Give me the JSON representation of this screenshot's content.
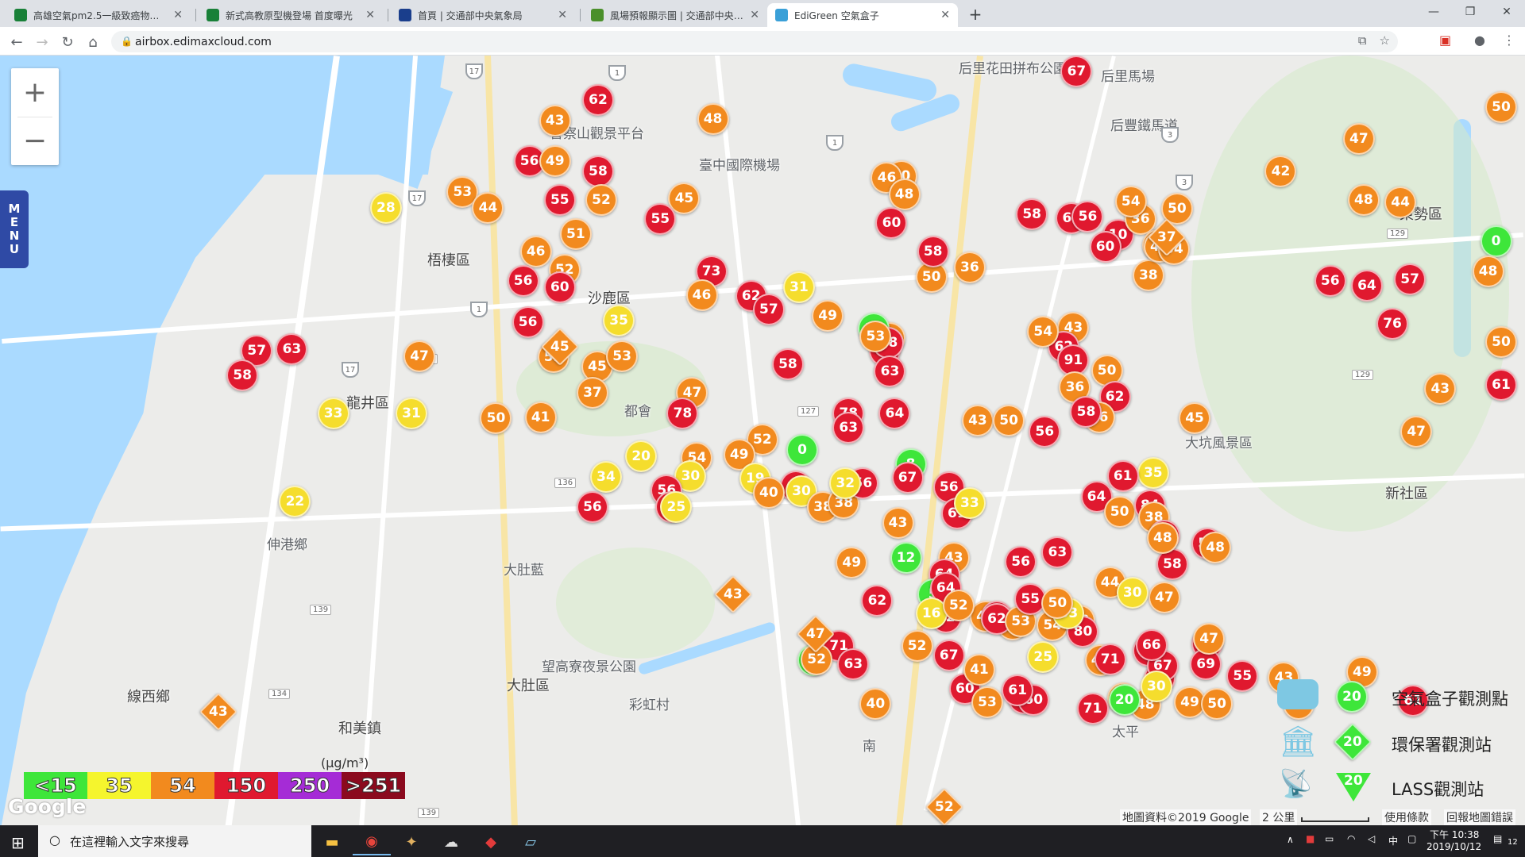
{
  "browser": {
    "tabs": [
      {
        "title": "高雄空氣pm2.5一級致癌物又襲",
        "fav_color": "#188038",
        "fav_char": "□"
      },
      {
        "title": "新式高教原型機登場 首度曝光",
        "fav_color": "#188038",
        "fav_char": "□"
      },
      {
        "title": "首頁 | 交通部中央氣象局",
        "fav_color": "#1a3e8c",
        "fav_char": "◎"
      },
      {
        "title": "風場預報顯示圖 | 交通部中央氣象",
        "fav_color": "#4a8f2a",
        "fav_char": "▲"
      },
      {
        "title": "EdiGreen 空氣盒子",
        "fav_color": "#3aa0d8",
        "fav_char": "▣"
      }
    ],
    "new_tab": "+",
    "url": "airbox.edimaxcloud.com"
  },
  "map": {
    "zoom_in": "+",
    "zoom_out": "−",
    "menu_letters": [
      "M",
      "E",
      "N",
      "U"
    ],
    "places": [
      {
        "name": "后里花田拼布公園"
      },
      {
        "name": "后里馬場"
      },
      {
        "name": "后豐鐵馬道"
      },
      {
        "name": "警察山觀景平台"
      },
      {
        "name": "臺中國際機場"
      },
      {
        "name": "東勢區"
      },
      {
        "name": "梧棲區"
      },
      {
        "name": "沙鹿區"
      },
      {
        "name": "都會"
      },
      {
        "name": "龍井區"
      },
      {
        "name": "大坑風景區"
      },
      {
        "name": "新社區"
      },
      {
        "name": "伸港鄉"
      },
      {
        "name": "大肚區"
      },
      {
        "name": "大肚藍"
      },
      {
        "name": "望高寮夜景公園"
      },
      {
        "name": "彩虹村"
      },
      {
        "name": "線西鄉"
      },
      {
        "name": "和美鎮"
      },
      {
        "name": "太平"
      },
      {
        "name": "南"
      },
      {
        "name": "大里"
      },
      {
        "name": "中"
      }
    ],
    "markers": [
      {
        "v": "62",
        "c": "#e0192f"
      },
      {
        "v": "43",
        "c": "#f28a1e"
      },
      {
        "v": "48",
        "c": "#f28a1e"
      },
      {
        "v": "56",
        "c": "#e0192f"
      },
      {
        "v": "49",
        "c": "#f28a1e"
      },
      {
        "v": "58",
        "c": "#e0192f"
      },
      {
        "v": "53",
        "c": "#f28a1e"
      },
      {
        "v": "44",
        "c": "#f28a1e"
      },
      {
        "v": "55",
        "c": "#e0192f"
      },
      {
        "v": "52",
        "c": "#f28a1e"
      },
      {
        "v": "45",
        "c": "#f28a1e"
      },
      {
        "v": "55",
        "c": "#e0192f"
      },
      {
        "v": "28",
        "c": "#f5dd2d"
      },
      {
        "v": "51",
        "c": "#f28a1e"
      },
      {
        "v": "46",
        "c": "#f28a1e"
      },
      {
        "v": "52",
        "c": "#f28a1e"
      },
      {
        "v": "56",
        "c": "#e0192f"
      },
      {
        "v": "60",
        "c": "#e0192f"
      },
      {
        "v": "73",
        "c": "#e0192f"
      },
      {
        "v": "50",
        "c": "#f28a1e"
      },
      {
        "v": "57",
        "c": "#e0192f"
      },
      {
        "v": "63",
        "c": "#e0192f"
      },
      {
        "v": "58",
        "c": "#e0192f"
      },
      {
        "v": "47",
        "c": "#f28a1e"
      },
      {
        "v": "56",
        "c": "#e0192f"
      },
      {
        "v": "35",
        "c": "#f5dd2d"
      },
      {
        "v": "52",
        "c": "#f28a1e"
      },
      {
        "v": "45",
        "c": "#f28a1e"
      },
      {
        "v": "53",
        "c": "#f28a1e"
      },
      {
        "v": "46",
        "c": "#f28a1e"
      },
      {
        "v": "37",
        "c": "#f28a1e"
      },
      {
        "v": "33",
        "c": "#f5dd2d"
      },
      {
        "v": "31",
        "c": "#f5dd2d"
      },
      {
        "v": "50",
        "c": "#f28a1e"
      },
      {
        "v": "41",
        "c": "#f28a1e"
      },
      {
        "v": "50",
        "c": "#f28a1e"
      },
      {
        "v": "22",
        "c": "#f5dd2d"
      },
      {
        "v": "46",
        "c": "#f28a1e"
      },
      {
        "v": "48",
        "c": "#f28a1e"
      },
      {
        "v": "60",
        "c": "#e0192f"
      },
      {
        "v": "58",
        "c": "#e0192f"
      },
      {
        "v": "58",
        "c": "#e0192f"
      },
      {
        "v": "63",
        "c": "#e0192f"
      },
      {
        "v": "56",
        "c": "#e0192f"
      },
      {
        "v": "10",
        "c": "#e0192f"
      },
      {
        "v": "60",
        "c": "#e0192f"
      },
      {
        "v": "36",
        "c": "#f28a1e"
      },
      {
        "v": "51",
        "c": "#f28a1e"
      },
      {
        "v": "38",
        "c": "#f28a1e"
      },
      {
        "v": "54",
        "c": "#f28a1e"
      },
      {
        "v": "50",
        "c": "#f28a1e"
      },
      {
        "v": "45",
        "c": "#f28a1e"
      },
      {
        "v": "42",
        "c": "#f28a1e"
      },
      {
        "v": "54",
        "c": "#f28a1e"
      },
      {
        "v": "36",
        "c": "#f28a1e"
      },
      {
        "v": "47",
        "c": "#f28a1e"
      },
      {
        "v": "48",
        "c": "#f28a1e"
      },
      {
        "v": "44",
        "c": "#f28a1e"
      },
      {
        "v": "0",
        "c": "#3ee63a"
      },
      {
        "v": "48",
        "c": "#f28a1e"
      },
      {
        "v": "56",
        "c": "#e0192f"
      },
      {
        "v": "64",
        "c": "#e0192f"
      },
      {
        "v": "57",
        "c": "#e0192f"
      },
      {
        "v": "76",
        "c": "#e0192f"
      },
      {
        "v": "50",
        "c": "#f28a1e"
      },
      {
        "v": "61",
        "c": "#e0192f"
      },
      {
        "v": "43",
        "c": "#f28a1e"
      },
      {
        "v": "47",
        "c": "#f28a1e"
      },
      {
        "v": "45",
        "c": "#f28a1e"
      },
      {
        "v": "50",
        "c": "#f28a1e"
      },
      {
        "v": "49",
        "c": "#f28a1e"
      },
      {
        "v": "62",
        "c": "#e0192f"
      },
      {
        "v": "57",
        "c": "#e0192f"
      },
      {
        "v": "31",
        "c": "#f5dd2d"
      },
      {
        "v": "49",
        "c": "#f28a1e"
      },
      {
        "v": "10",
        "c": "#3ee63a"
      },
      {
        "v": "58",
        "c": "#e0192f"
      },
      {
        "v": "78",
        "c": "#e0192f"
      },
      {
        "v": "58",
        "c": "#e0192f"
      },
      {
        "v": "53",
        "c": "#f28a1e"
      },
      {
        "v": "43",
        "c": "#f28a1e"
      },
      {
        "v": "62",
        "c": "#e0192f"
      },
      {
        "v": "54",
        "c": "#f28a1e"
      },
      {
        "v": "91",
        "c": "#e0192f"
      },
      {
        "v": "50",
        "c": "#f28a1e"
      },
      {
        "v": "36",
        "c": "#f28a1e"
      },
      {
        "v": "62",
        "c": "#e0192f"
      },
      {
        "v": "46",
        "c": "#f28a1e"
      },
      {
        "v": "58",
        "c": "#e0192f"
      },
      {
        "v": "47",
        "c": "#f28a1e"
      },
      {
        "v": "78",
        "c": "#e0192f"
      },
      {
        "v": "78",
        "c": "#e0192f"
      },
      {
        "v": "64",
        "c": "#e0192f"
      },
      {
        "v": "63",
        "c": "#e0192f"
      },
      {
        "v": "43",
        "c": "#f28a1e"
      },
      {
        "v": "50",
        "c": "#f28a1e"
      },
      {
        "v": "56",
        "c": "#e0192f"
      },
      {
        "v": "63",
        "c": "#e0192f"
      },
      {
        "v": "52",
        "c": "#f28a1e"
      },
      {
        "v": "54",
        "c": "#f28a1e"
      },
      {
        "v": "20",
        "c": "#f5dd2d"
      },
      {
        "v": "0",
        "c": "#3ee63a"
      },
      {
        "v": "49",
        "c": "#f28a1e"
      },
      {
        "v": "30",
        "c": "#f5dd2d"
      },
      {
        "v": "56",
        "c": "#e0192f"
      },
      {
        "v": "34",
        "c": "#f5dd2d"
      },
      {
        "v": "60",
        "c": "#e0192f"
      },
      {
        "v": "67",
        "c": "#e0192f"
      },
      {
        "v": "56",
        "c": "#e0192f"
      },
      {
        "v": "19",
        "c": "#f5dd2d"
      },
      {
        "v": "30",
        "c": "#f5dd2d"
      },
      {
        "v": "40",
        "c": "#f28a1e"
      },
      {
        "v": "25",
        "c": "#f5dd2d"
      },
      {
        "v": "38",
        "c": "#f28a1e"
      },
      {
        "v": "38",
        "c": "#f28a1e"
      },
      {
        "v": "8",
        "c": "#3ee63a"
      },
      {
        "v": "56",
        "c": "#e0192f"
      },
      {
        "v": "67",
        "c": "#e0192f"
      },
      {
        "v": "56",
        "c": "#e0192f"
      },
      {
        "v": "43",
        "c": "#f28a1e"
      },
      {
        "v": "61",
        "c": "#e0192f"
      },
      {
        "v": "33",
        "c": "#f5dd2d"
      },
      {
        "v": "32",
        "c": "#f5dd2d"
      },
      {
        "v": "35",
        "c": "#f5dd2d"
      },
      {
        "v": "64",
        "c": "#e0192f"
      },
      {
        "v": "50",
        "c": "#f28a1e"
      },
      {
        "v": "84",
        "c": "#e0192f"
      },
      {
        "v": "38",
        "c": "#f28a1e"
      },
      {
        "v": "61",
        "c": "#e0192f"
      },
      {
        "v": "59",
        "c": "#e0192f"
      },
      {
        "v": "49",
        "c": "#f28a1e"
      },
      {
        "v": "12",
        "c": "#3ee63a"
      },
      {
        "v": "43",
        "c": "#f28a1e"
      },
      {
        "v": "56",
        "c": "#e0192f"
      },
      {
        "v": "63",
        "c": "#e0192f"
      },
      {
        "v": "58",
        "c": "#e0192f"
      },
      {
        "v": "47",
        "c": "#f28a1e"
      },
      {
        "v": "44",
        "c": "#f28a1e"
      },
      {
        "v": "64",
        "c": "#e0192f"
      },
      {
        "v": "30",
        "c": "#f5dd2d"
      },
      {
        "v": "56",
        "c": "#e0192f"
      },
      {
        "v": "48",
        "c": "#f28a1e"
      },
      {
        "v": "67",
        "c": "#e0192f"
      },
      {
        "v": "48",
        "c": "#f28a1e"
      },
      {
        "v": "5",
        "c": "#3ee63a"
      },
      {
        "v": "62",
        "c": "#e0192f"
      },
      {
        "v": "59",
        "c": "#e0192f"
      },
      {
        "v": "47",
        "c": "#f28a1e"
      },
      {
        "v": "62",
        "c": "#e0192f"
      },
      {
        "v": "55",
        "c": "#e0192f"
      },
      {
        "v": "44",
        "c": "#f28a1e"
      },
      {
        "v": "62",
        "c": "#e0192f"
      },
      {
        "v": "64",
        "c": "#e0192f"
      },
      {
        "v": "71",
        "c": "#e0192f"
      },
      {
        "v": "40",
        "c": "#f28a1e"
      },
      {
        "v": "16",
        "c": "#f5dd2d"
      },
      {
        "v": "52",
        "c": "#f28a1e"
      },
      {
        "v": "67",
        "c": "#e0192f"
      },
      {
        "v": "53",
        "c": "#f28a1e"
      },
      {
        "v": "54",
        "c": "#f28a1e"
      },
      {
        "v": "38",
        "c": "#f28a1e"
      },
      {
        "v": "80",
        "c": "#e0192f"
      },
      {
        "v": "55",
        "c": "#e0192f"
      },
      {
        "v": "33",
        "c": "#f5dd2d"
      },
      {
        "v": "4",
        "c": "#3ee63a"
      },
      {
        "v": "52",
        "c": "#f28a1e"
      },
      {
        "v": "25",
        "c": "#f5dd2d"
      },
      {
        "v": "41",
        "c": "#f28a1e"
      },
      {
        "v": "50",
        "c": "#f28a1e"
      },
      {
        "v": "61",
        "c": "#e0192f"
      },
      {
        "v": "66",
        "c": "#e0192f"
      },
      {
        "v": "81",
        "c": "#e0192f"
      },
      {
        "v": "67",
        "c": "#e0192f"
      },
      {
        "v": "69",
        "c": "#e0192f"
      },
      {
        "v": "47",
        "c": "#f28a1e"
      },
      {
        "v": "66",
        "c": "#e0192f"
      },
      {
        "v": "71",
        "c": "#e0192f"
      },
      {
        "v": "60",
        "c": "#e0192f"
      },
      {
        "v": "63",
        "c": "#e0192f"
      },
      {
        "v": "52",
        "c": "#f28a1e"
      },
      {
        "v": "60",
        "c": "#e0192f"
      },
      {
        "v": "61",
        "c": "#e0192f"
      },
      {
        "v": "41",
        "c": "#f28a1e"
      },
      {
        "v": "53",
        "c": "#f28a1e"
      },
      {
        "v": "36",
        "c": "#f28a1e"
      },
      {
        "v": "49",
        "c": "#f28a1e"
      },
      {
        "v": "48",
        "c": "#f28a1e"
      },
      {
        "v": "71",
        "c": "#e0192f"
      },
      {
        "v": "30",
        "c": "#f5dd2d"
      },
      {
        "v": "55",
        "c": "#e0192f"
      },
      {
        "v": "53",
        "c": "#f28a1e"
      },
      {
        "v": "43",
        "c": "#f28a1e"
      },
      {
        "v": "49",
        "c": "#f28a1e"
      },
      {
        "v": "61",
        "c": "#e0192f"
      },
      {
        "v": "50",
        "c": "#f28a1e"
      },
      {
        "v": "20",
        "c": "#3ee63a"
      }
    ],
    "diamonds": [
      {
        "v": "45",
        "c": "#f28a1e"
      },
      {
        "v": "37",
        "c": "#f28a1e"
      },
      {
        "v": "43",
        "c": "#f28a1e"
      },
      {
        "v": "47",
        "c": "#f28a1e"
      },
      {
        "v": "43",
        "c": "#f28a1e"
      },
      {
        "v": "52",
        "c": "#f28a1e"
      }
    ],
    "scale": [
      {
        "label": "<15",
        "color": "#3ee63a"
      },
      {
        "label": "35",
        "color": "#f5f52d"
      },
      {
        "label": "54",
        "color": "#f28a1e"
      },
      {
        "label": "150",
        "color": "#e0192f"
      },
      {
        "label": "250",
        "color": "#a52cd6"
      },
      {
        "label": ">251",
        "color": "#8b0a1e"
      }
    ],
    "unit": "(μg/m³)",
    "google_logo": "Google",
    "station_legend": [
      {
        "value": "20",
        "label": "空氣盒子觀測點"
      },
      {
        "value": "20",
        "label": "環保署觀測站"
      },
      {
        "value": "20",
        "label": "LASS觀測站"
      }
    ],
    "attribution": "地圖資料©2019 Google",
    "scale_bar": "2 公里",
    "terms": "使用條款",
    "report": "回報地圖錯誤"
  },
  "taskbar": {
    "search_placeholder": "在這裡輸入文字來搜尋",
    "time": "下午 10:38",
    "date": "2019/10/12",
    "ime": "中",
    "notif_count": "12"
  }
}
